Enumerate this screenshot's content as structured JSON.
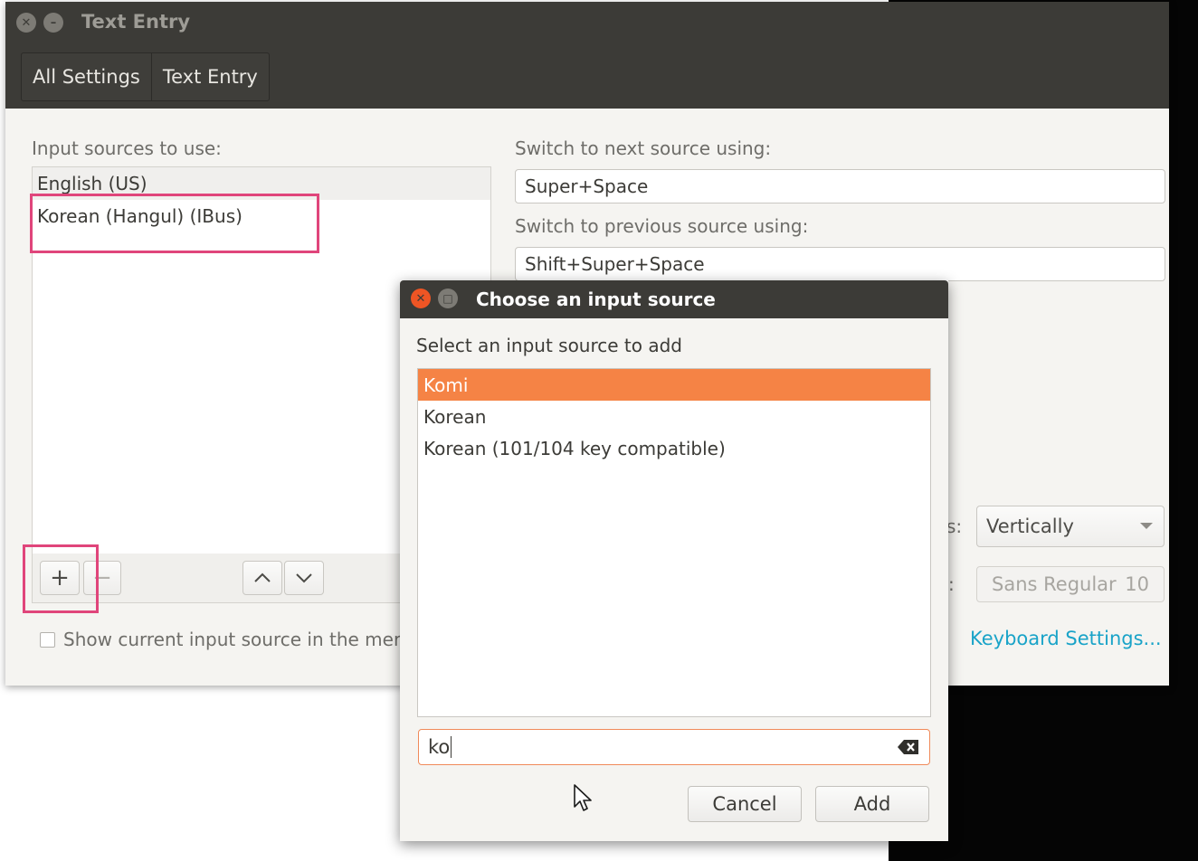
{
  "window": {
    "title": "Text Entry",
    "breadcrumb": [
      "All Settings",
      "Text Entry"
    ]
  },
  "left": {
    "label": "Input sources to use:",
    "sources": [
      "English (US)",
      "Korean (Hangul) (IBus)"
    ],
    "add_label": "+",
    "remove_label": "−",
    "show_source_label": "Show current input source in the mer"
  },
  "right": {
    "next_label": "Switch to next source using:",
    "next_value": "Super+Space",
    "prev_label": "Switch to previous source using:",
    "prev_value": "Shift+Super+Space",
    "orientation_label_partial": "s:",
    "orientation_value": "Vertically",
    "font_label_partial": ":",
    "font_name": "Sans Regular",
    "font_size": "10",
    "keyboard_settings_link": "Keyboard Settings..."
  },
  "dialog": {
    "title": "Choose an input source",
    "prompt": "Select an input source to add",
    "options": [
      "Komi",
      "Korean",
      "Korean (101/104 key compatible)"
    ],
    "selected_index": 0,
    "search_value": "ko",
    "cancel_label": "Cancel",
    "add_label": "Add"
  },
  "colors": {
    "selection": "#f58345",
    "highlight_annotation": "#e0457b",
    "link": "#19a3c8",
    "titlebar": "#3c3b37"
  }
}
